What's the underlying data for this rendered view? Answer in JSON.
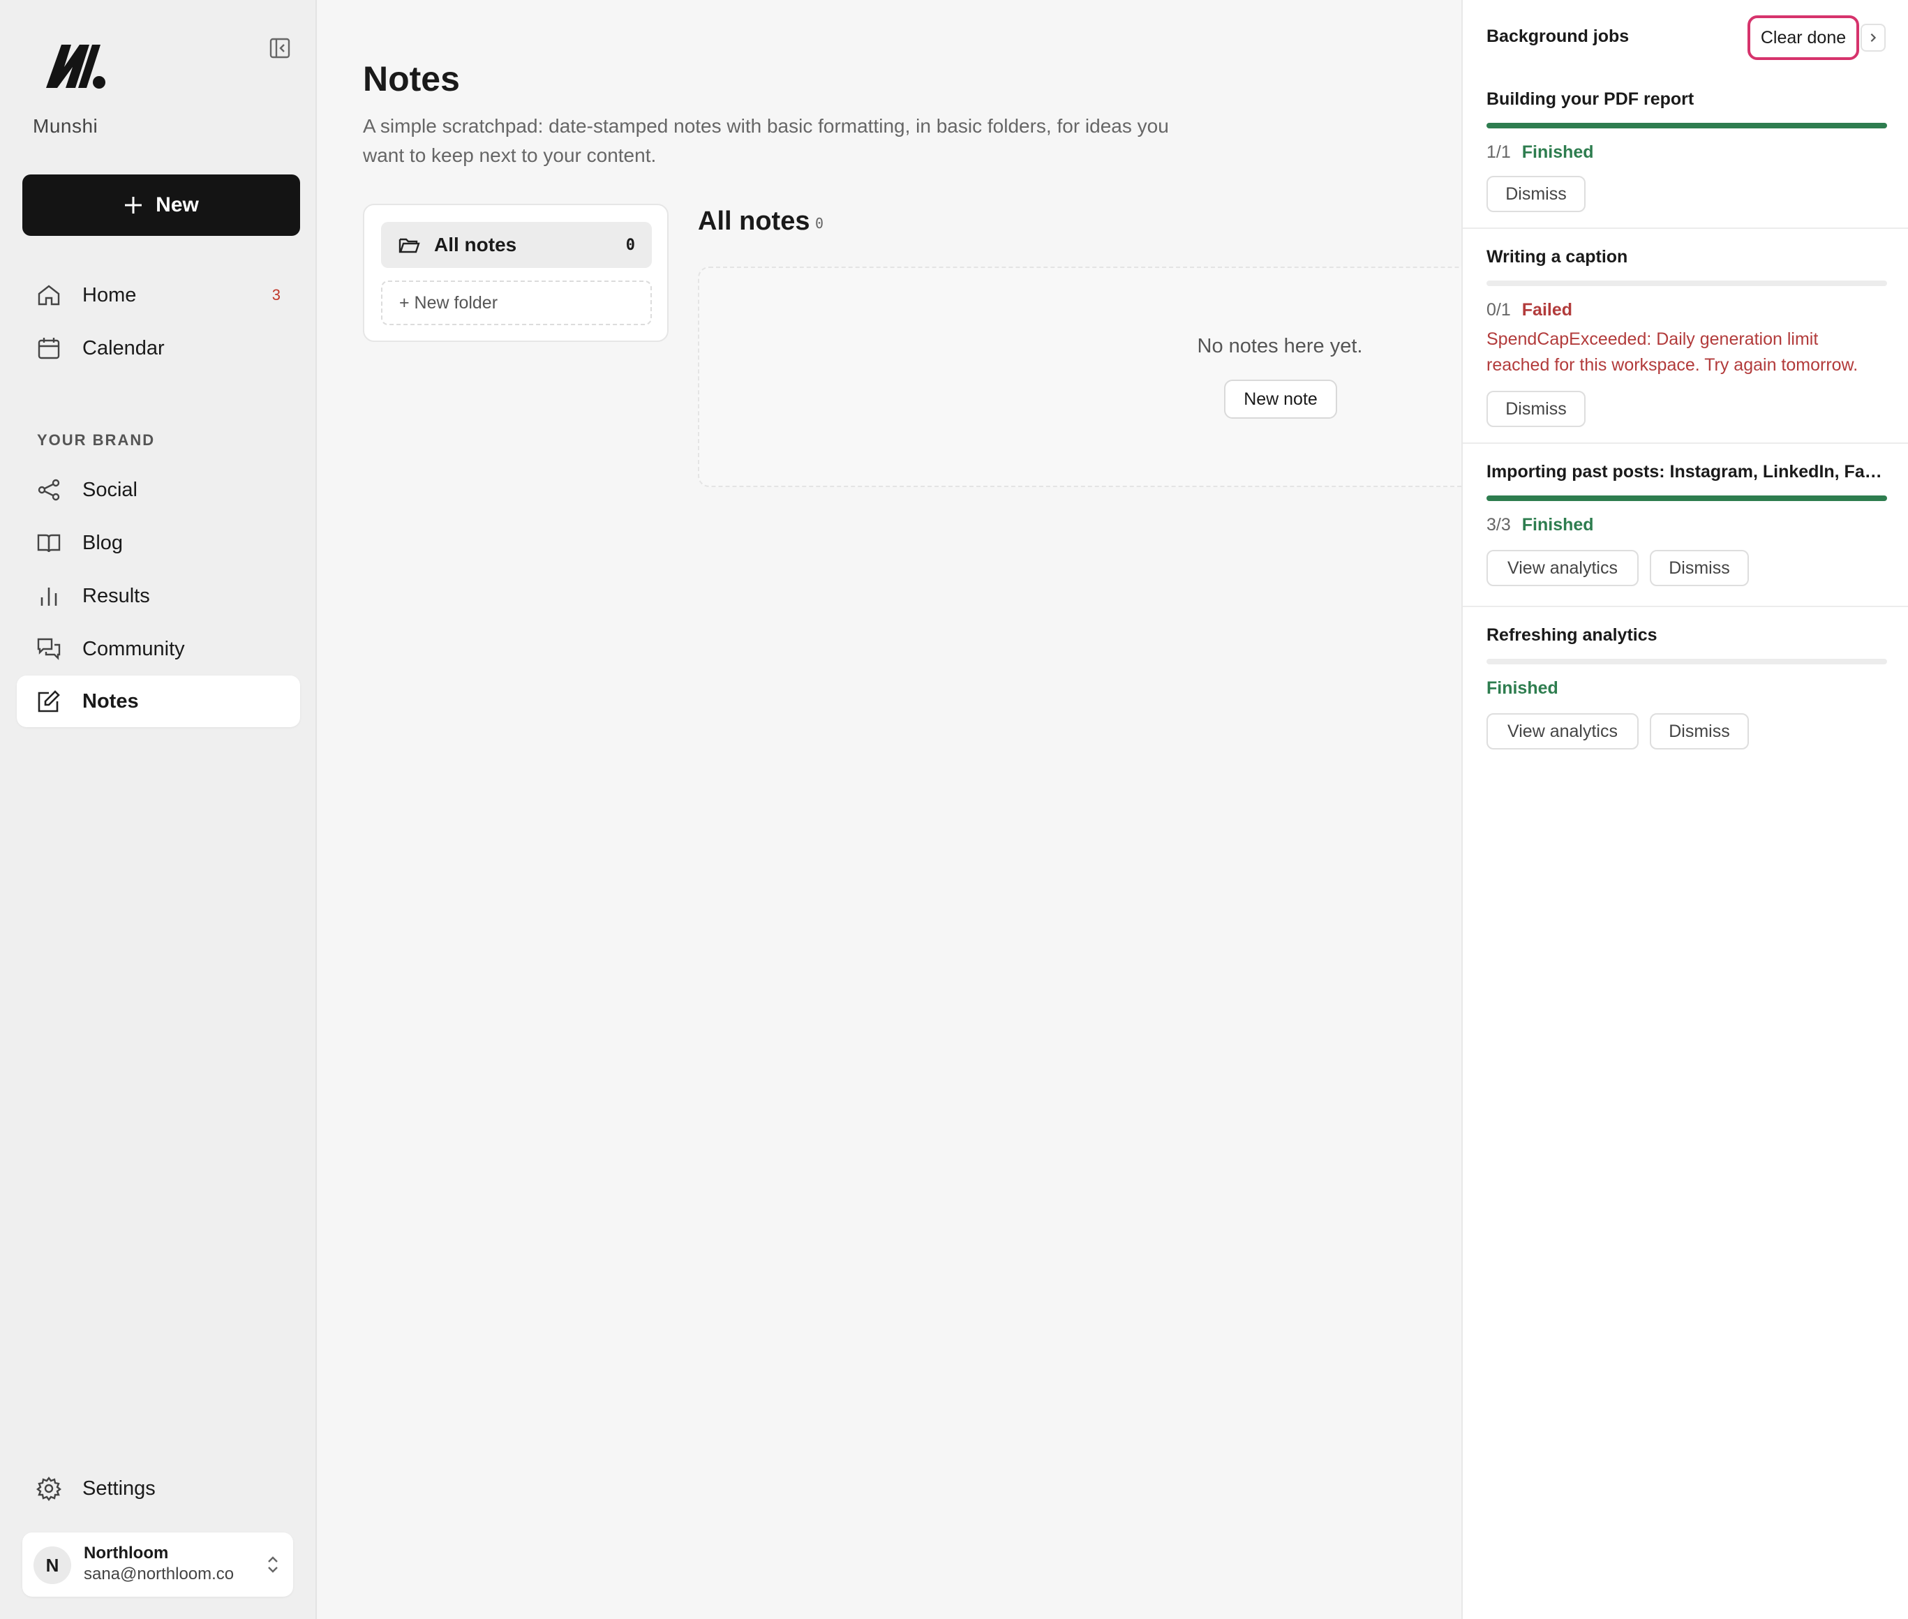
{
  "sidebar": {
    "brand_name": "Munshi",
    "new_label": "New",
    "nav": [
      {
        "label": "Home",
        "badge": "3"
      },
      {
        "label": "Calendar"
      }
    ],
    "section_label": "YOUR BRAND",
    "brand_nav": [
      {
        "label": "Social"
      },
      {
        "label": "Blog"
      },
      {
        "label": "Results"
      },
      {
        "label": "Community"
      },
      {
        "label": "Notes"
      }
    ],
    "settings_label": "Settings",
    "account": {
      "initial": "N",
      "name": "Northloom",
      "email": "sana@northloom.co"
    }
  },
  "main": {
    "title": "Notes",
    "description": "A simple scratchpad: date-stamped notes with basic formatting, in basic folders, for ideas you want to keep next to your content.",
    "folders": {
      "all_label": "All notes",
      "all_count": "0",
      "new_folder_label": "+ New folder"
    },
    "list_title": "All notes",
    "list_count": "0",
    "empty_text": "No notes here yet.",
    "new_note_label": "New note"
  },
  "jobs": {
    "title": "Background jobs",
    "clear_done_label": "Clear done",
    "items": [
      {
        "title": "Building your PDF report",
        "progress": 1.0,
        "count": "1/1",
        "status": "Finished",
        "actions": [
          "Dismiss"
        ]
      },
      {
        "title": "Writing a caption",
        "progress": 0.0,
        "count": "0/1",
        "status": "Failed",
        "error": "SpendCapExceeded: Daily generation limit reached for this workspace. Try again tomorrow.",
        "actions": [
          "Dismiss"
        ]
      },
      {
        "title": "Importing past posts: Instagram, LinkedIn, Face...",
        "progress": 1.0,
        "count": "3/3",
        "status": "Finished",
        "actions": [
          "View analytics",
          "Dismiss"
        ]
      },
      {
        "title": "Refreshing analytics",
        "progress": 0.0,
        "count": "",
        "status": "Finished",
        "actions": [
          "View analytics",
          "Dismiss"
        ]
      }
    ]
  },
  "colors": {
    "accent_dark": "#141414",
    "success": "#2e7d4f",
    "error": "#b23b3b",
    "highlight": "#d6336c",
    "badge": "#c0392b"
  }
}
